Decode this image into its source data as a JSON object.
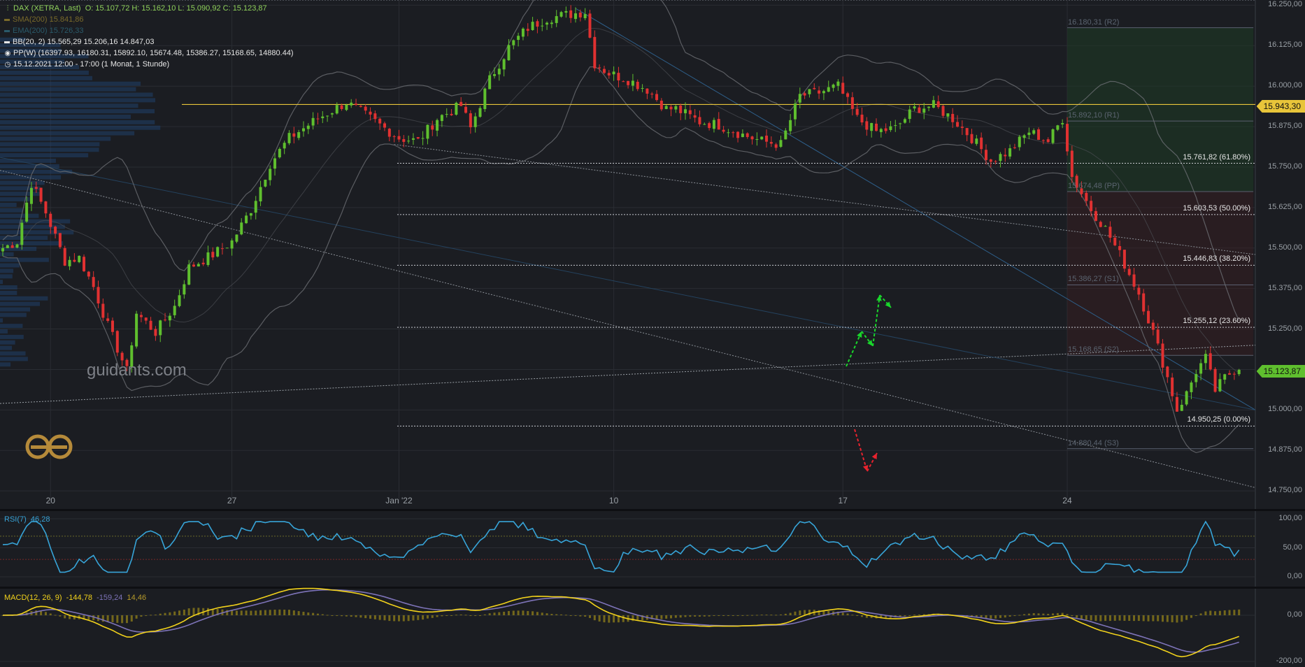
{
  "header": {
    "instrument": "DAX (XETRA, Last)",
    "ohlc": "O: 15.107,72  H: 15.162,10  L: 15.090,92  C: 15.123,87",
    "sma": "SMA(200)  15.841,86",
    "ema": "EMA(200)  15.726,33",
    "bb": "BB(20, 2)  15.565,29  15.206,16  14.847,03",
    "pp": "PP(W)  (16397.93, 16180.31, 15892.10, 15674.48, 15386.27, 15168.65, 14880.44)",
    "period": "15.12.2021 12:00 - 17:00   (1 Monat, 1 Stunde)"
  },
  "colors": {
    "background": "#1b1d22",
    "grid": "#2a2d33",
    "up": "#5fbf2e",
    "down": "#e03131",
    "bb": "#6b6e73",
    "highlight": "#e8c53a",
    "rsi": "#37a4d8",
    "macd": "#f2d21b",
    "signal": "#7d73b8",
    "ema_trend": "#2e5f8a",
    "arrow_up": "#19d62b",
    "arrow_down": "#e8232e"
  },
  "icons": [
    "candles-icon",
    "line-swatch-icon",
    "target-icon",
    "clock-icon",
    "guidants-logo-icon"
  ],
  "price_tags": {
    "level": "15.943,30",
    "last": "15.123,87"
  },
  "pivots": [
    {
      "label": "16.180,31 (R2)",
      "value": 16180.31
    },
    {
      "label": "15.892,10 (R1)",
      "value": 15892.1
    },
    {
      "label": "15.674,48 (PP)",
      "value": 15674.48
    },
    {
      "label": "15.386,27 (S1)",
      "value": 15386.27
    },
    {
      "label": "15.168,65 (S2)",
      "value": 15168.65
    },
    {
      "label": "14.880,44 (S3)",
      "value": 14880.44
    }
  ],
  "fib": [
    {
      "label": "15.761,82 (61.80%)",
      "value": 15761.82
    },
    {
      "label": "15.603,53 (50.00%)",
      "value": 15603.53
    },
    {
      "label": "15.446,83 (38.20%)",
      "value": 15446.83
    },
    {
      "label": "15.255,12 (23.60%)",
      "value": 15255.12
    },
    {
      "label": "14.950,25 (0.00%)",
      "value": 14950.25
    }
  ],
  "logo_text": "guidants.com",
  "rsi_panel": {
    "label": "RSI(7)",
    "value": "46,28",
    "ticks": [
      "100,00",
      "50,00",
      "0,00"
    ]
  },
  "macd_panel": {
    "label": "MACD(12, 26, 9)",
    "v1": "-144,78",
    "v2": "-159,24",
    "v3": "14,46",
    "ticks": [
      "0,00",
      "-200,00"
    ]
  },
  "chart_data": {
    "type": "candlestick",
    "title": "DAX (XETRA, Last)",
    "interval": "1 Stunde",
    "y_ticks": [
      "16.250,00",
      "16.125,00",
      "16.000,00",
      "15.875,00",
      "15.750,00",
      "15.625,00",
      "15.500,00",
      "15.375,00",
      "15.250,00",
      "15.125,00",
      "15.000,00",
      "14.875,00",
      "14.750,00"
    ],
    "y_tick_values": [
      16250,
      16125,
      16000,
      15875,
      15750,
      15625,
      15500,
      15375,
      15250,
      15125,
      15000,
      14875,
      14750
    ],
    "ylim": [
      14733,
      16266
    ],
    "x_ticks": [
      "20",
      "27",
      "Jan '22",
      "10",
      "17",
      "24"
    ],
    "x_tick_index": [
      10,
      48,
      83,
      128,
      176,
      223
    ],
    "bars_n": 260,
    "highlight_level": 15943.3,
    "last_price": 15123.87,
    "close_path": [
      [
        0,
        15500
      ],
      [
        3,
        15520
      ],
      [
        6,
        15700
      ],
      [
        9,
        15610
      ],
      [
        13,
        15460
      ],
      [
        16,
        15470
      ],
      [
        19,
        15380
      ],
      [
        22,
        15260
      ],
      [
        26,
        15120
      ],
      [
        28,
        15300
      ],
      [
        32,
        15240
      ],
      [
        36,
        15320
      ],
      [
        39,
        15440
      ],
      [
        44,
        15480
      ],
      [
        48,
        15520
      ],
      [
        52,
        15620
      ],
      [
        56,
        15760
      ],
      [
        60,
        15840
      ],
      [
        66,
        15900
      ],
      [
        72,
        15950
      ],
      [
        78,
        15890
      ],
      [
        83,
        15840
      ],
      [
        87,
        15830
      ],
      [
        91,
        15900
      ],
      [
        96,
        15940
      ],
      [
        98,
        15870
      ],
      [
        102,
        16020
      ],
      [
        106,
        16120
      ],
      [
        110,
        16180
      ],
      [
        114,
        16210
      ],
      [
        118,
        16220
      ],
      [
        122,
        16230
      ],
      [
        124,
        16070
      ],
      [
        127,
        16040
      ],
      [
        131,
        16020
      ],
      [
        135,
        15990
      ],
      [
        139,
        15930
      ],
      [
        141,
        15930
      ],
      [
        146,
        15890
      ],
      [
        150,
        15880
      ],
      [
        155,
        15850
      ],
      [
        159,
        15830
      ],
      [
        163,
        15820
      ],
      [
        167,
        15970
      ],
      [
        171,
        15980
      ],
      [
        175,
        16000
      ],
      [
        179,
        15900
      ],
      [
        183,
        15860
      ],
      [
        187,
        15870
      ],
      [
        191,
        15930
      ],
      [
        195,
        15940
      ],
      [
        199,
        15900
      ],
      [
        203,
        15840
      ],
      [
        207,
        15770
      ],
      [
        211,
        15800
      ],
      [
        215,
        15860
      ],
      [
        219,
        15830
      ],
      [
        222,
        15900
      ],
      [
        224,
        15720
      ],
      [
        228,
        15620
      ],
      [
        231,
        15560
      ],
      [
        234,
        15480
      ],
      [
        238,
        15360
      ],
      [
        241,
        15240
      ],
      [
        244,
        15100
      ],
      [
        246,
        15000
      ],
      [
        248,
        15050
      ],
      [
        250,
        15120
      ],
      [
        252,
        15160
      ],
      [
        254,
        15060
      ],
      [
        256,
        15100
      ],
      [
        258,
        15123.87
      ]
    ]
  }
}
